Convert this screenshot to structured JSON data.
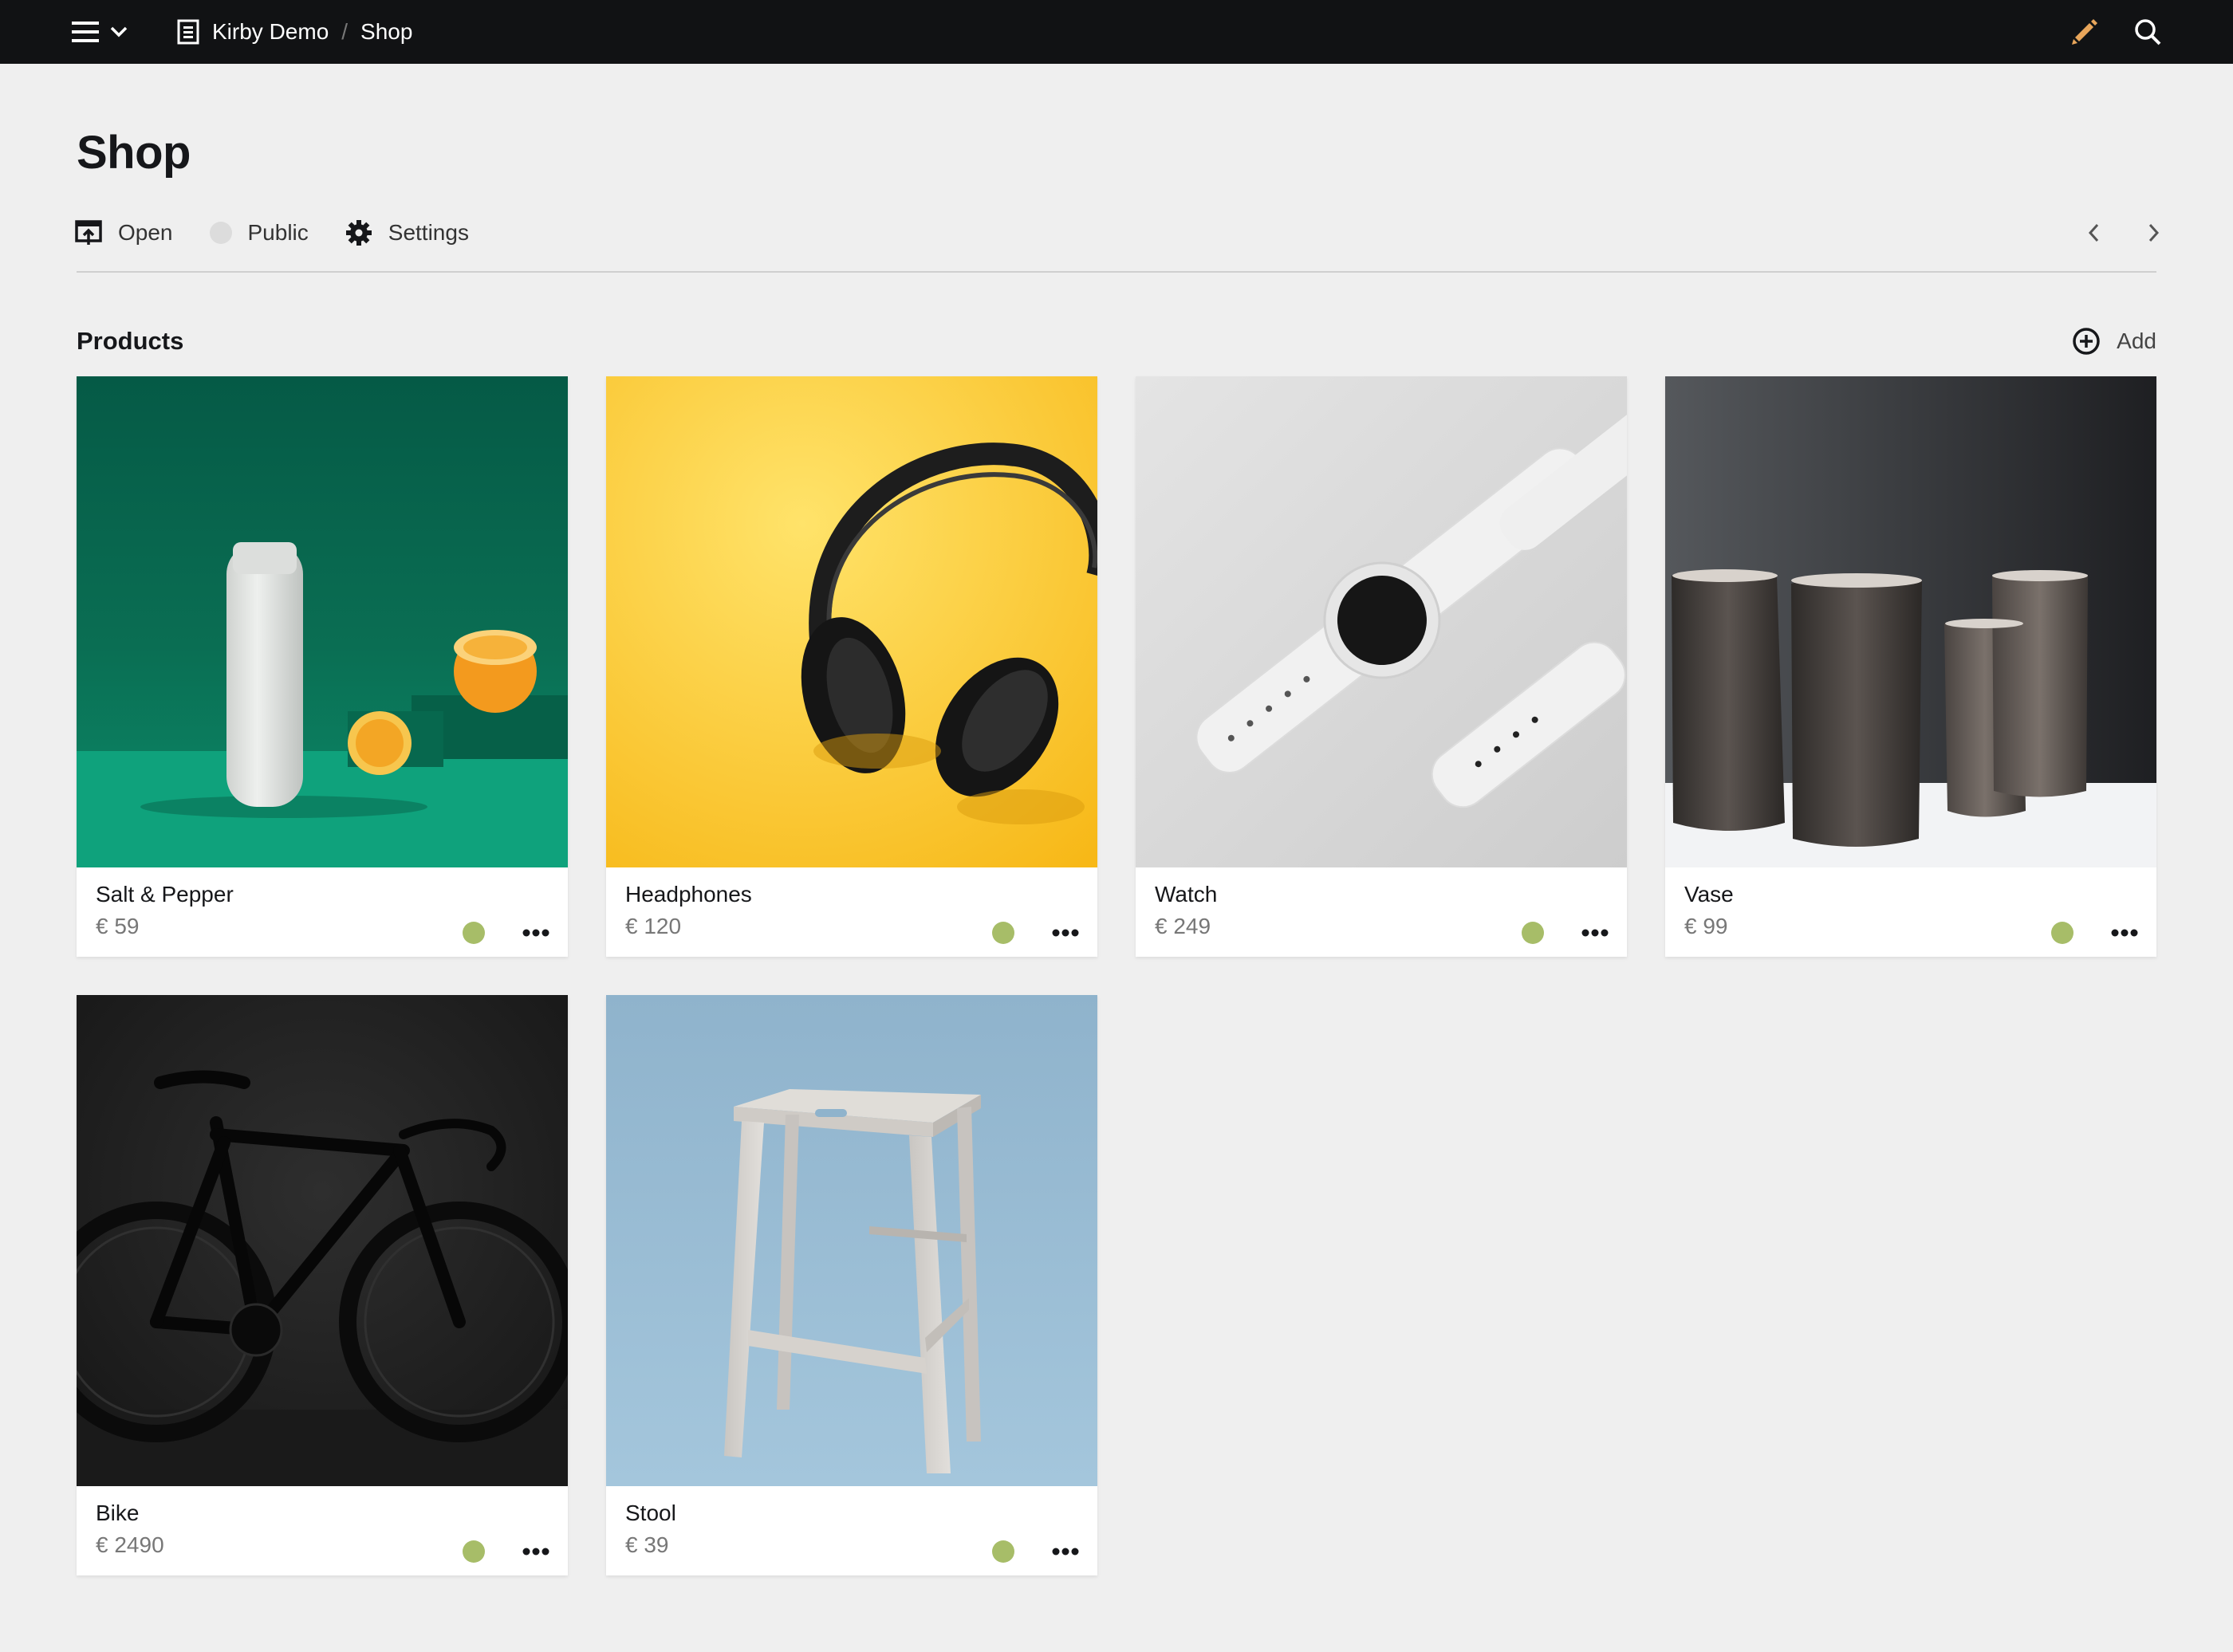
{
  "topbar": {
    "breadcrumbs": [
      "Kirby Demo",
      "Shop"
    ],
    "separator": "/",
    "edit_color": "#e8a55a"
  },
  "page": {
    "title": "Shop",
    "options": {
      "open_label": "Open",
      "status_label": "Public",
      "settings_label": "Settings"
    }
  },
  "section": {
    "title": "Products",
    "add_label": "Add"
  },
  "products": [
    {
      "name": "Salt & Pepper",
      "price": "€ 59",
      "status_color": "#a7bd68"
    },
    {
      "name": "Headphones",
      "price": "€ 120",
      "status_color": "#a7bd68"
    },
    {
      "name": "Watch",
      "price": "€ 249",
      "status_color": "#a7bd68"
    },
    {
      "name": "Vase",
      "price": "€ 99",
      "status_color": "#a7bd68"
    },
    {
      "name": "Bike",
      "price": "€ 2490",
      "status_color": "#a7bd68"
    },
    {
      "name": "Stool",
      "price": "€ 39",
      "status_color": "#a7bd68"
    }
  ]
}
